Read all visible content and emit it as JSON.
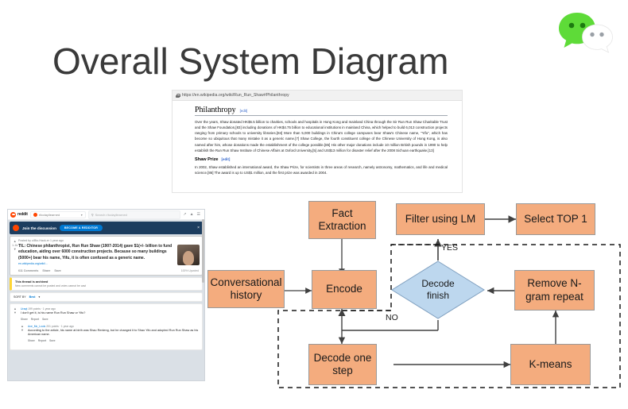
{
  "slide": {
    "title": "Overall System Diagram",
    "logo": {
      "name": "wechat-logo",
      "green": "#5EDB38",
      "white": "#FFFFFF",
      "eye_dark": "#1d8a0d",
      "eye_gray": "#9aa0a6"
    }
  },
  "wikipedia": {
    "url": "https://en.wikipedia.org/wiki/Run_Run_Shaw#Philanthropy",
    "lock_icon": "lock-icon",
    "section1": {
      "heading": "Philanthropy",
      "edit": "edit",
      "bracket_open": "[",
      "bracket_close": "]",
      "paragraph": "Over the years, Shaw donated HK$6.5 billion to charities, schools and hospitals in Hong Kong and mainland China through the Sir Run Run Shaw Charitable Trust and the Shaw Foundation,[83] including donations of HK$4.75 billion to educational institutions in mainland China, which helped to build 6,013 construction projects ranging from primary schools to university libraries.[84] More than 5,000 buildings in China's college campuses bear Shaw's Chinese name, \"Yifu\", which has become so ubiquitous that many mistake it as a generic name.[7] Shaw College, the fourth constituent college of the Chinese University of Hong Kong, is also named after him, whose donations made the establishment of the college possible.[85] His other major donations include 10 million British pounds in 1990 to help establish the Run Run Shaw Institute of Chinese Affairs at Oxford University,[5] and US$13 million for disaster relief after the 2008 Sichuan earthquake.[13]"
    },
    "section2": {
      "heading": "Shaw Prize",
      "edit": "edit",
      "paragraph": "In 2002, Shaw established an international award, the Shaw Prize, for scientists in three areas of research, namely astronomy, mathematics, and life and medical science.[86] The award is up to US$1 million, and the first prize was awarded in 2004."
    }
  },
  "reddit": {
    "logo_text": "reddit",
    "subreddit": "r/todayilearned",
    "caret": "▾",
    "search_icon": "search-icon",
    "search_placeholder": "Search r/todayilearned",
    "top_icons": [
      "expand-icon",
      "notifications-icon",
      "menu-icon"
    ],
    "banner": {
      "text": "Join the discussion",
      "button": "BECOME A REDDITOR",
      "close": "×"
    },
    "post": {
      "meta": "Posted by u/Bio-Hack-er 1 year ago",
      "flair": "⭐",
      "title": "TIL: Chinese philanthropist, Run Run Shaw (1907-2014) gave $1(+/- billion to fund education, aiding over 6000 construction projects. Because so many buildings (5000+) bear his name, Yifu, it is often confused as a generic name.",
      "link": "en.wikipedia.org/wiki/...",
      "upvote": "▲",
      "score": "1.4k",
      "downvote": "▼",
      "actions": [
        "611 Comments",
        "Share",
        "Save"
      ],
      "sticky": "100% Upvoted"
    },
    "notice": {
      "title": "This thread is archived",
      "subtitle": "New comments cannot be posted and votes cannot be cast"
    },
    "sortbar": {
      "label": "SORT BY",
      "value": "Best",
      "caret": "▾"
    },
    "comments": [
      {
        "user": "Uraqt",
        "meta": "199 points · 1 year ago",
        "body": "I don't get it, is his name Run Run Shaw or Yifu?",
        "actions": [
          "Share",
          "Report",
          "Save"
        ]
      },
      {
        "user": "Ace_Mc_Louis",
        "meta": "201 points · 1 year ago",
        "body": "According to the article, his name at birth was Shao Renleng, but he changed it to Shao Yifu and adopted Run Run Shaw as his American name.",
        "actions": [
          "Share",
          "Report",
          "Save"
        ]
      }
    ]
  },
  "flowchart": {
    "colors": {
      "process_fill": "#F4AC7E",
      "process_stroke": "#9a9a9a",
      "decision_fill": "#BDD7EE",
      "decision_stroke": "#7f9fbf",
      "edge": "#404040",
      "dashed": "#1a1a1a"
    },
    "nodes": [
      {
        "id": "fact_extraction",
        "type": "process",
        "label": "Fact\nExtraction",
        "label_lines": [
          "Fact",
          "Extraction"
        ]
      },
      {
        "id": "filter_lm",
        "type": "process",
        "label": "Filter using LM",
        "label_lines": [
          "Filter using LM"
        ]
      },
      {
        "id": "select_top1",
        "type": "process",
        "label": "Select TOP 1",
        "label_lines": [
          "Select TOP 1"
        ]
      },
      {
        "id": "conv_history",
        "type": "process",
        "label": "Conversational\nhistory",
        "label_lines": [
          "Conversational",
          "history"
        ]
      },
      {
        "id": "encode",
        "type": "process",
        "label": "Encode",
        "label_lines": [
          "Encode"
        ]
      },
      {
        "id": "decode_finish",
        "type": "decision",
        "label": "Decode\nfinish",
        "label_lines": [
          "Decode",
          "finish"
        ]
      },
      {
        "id": "remove_ngram",
        "type": "process",
        "label": "Remove N-\ngram repeat",
        "label_lines": [
          "Remove N-",
          "gram repeat"
        ]
      },
      {
        "id": "decode_one_step",
        "type": "process",
        "label": "Decode one\nstep",
        "label_lines": [
          "Decode one",
          "step"
        ]
      },
      {
        "id": "kmeans",
        "type": "process",
        "label": "K-means",
        "label_lines": [
          "K-means"
        ]
      }
    ],
    "edge_labels": {
      "yes": "YES",
      "no": "NO"
    },
    "edges": [
      {
        "from": "fact_extraction",
        "to": "encode",
        "style": "solid"
      },
      {
        "from": "filter_lm",
        "to": "select_top1",
        "style": "solid"
      },
      {
        "from": "conv_history",
        "to": "encode",
        "style": "solid"
      },
      {
        "from": "decode_finish",
        "to": "filter_lm",
        "style": "solid",
        "label": "YES"
      },
      {
        "from": "decode_finish",
        "to": "encode",
        "style": "dashed",
        "label": "NO"
      },
      {
        "from": "remove_ngram",
        "to": "decode_finish",
        "style": "solid"
      },
      {
        "from": "encode",
        "to": "decode_one_step",
        "style": "solid"
      },
      {
        "from": "decode_one_step",
        "to": "kmeans",
        "style": "solid"
      },
      {
        "from": "kmeans",
        "to": "remove_ngram",
        "style": "solid"
      }
    ]
  }
}
